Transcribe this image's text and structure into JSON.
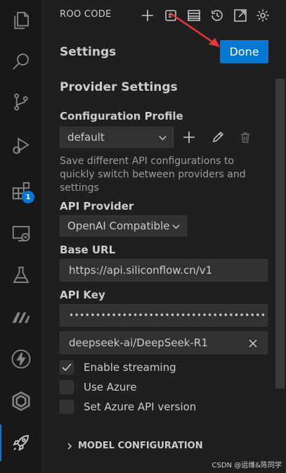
{
  "activity_bar": {
    "items": [
      {
        "icon": "files-icon"
      },
      {
        "icon": "search-icon"
      },
      {
        "icon": "source-control-icon"
      },
      {
        "icon": "run-debug-icon"
      },
      {
        "icon": "extensions-icon",
        "badge": "1"
      },
      {
        "icon": "remote-explorer-icon"
      },
      {
        "icon": "testing-icon"
      },
      {
        "icon": "m-logo-icon"
      },
      {
        "icon": "lightning-icon"
      },
      {
        "icon": "hexagon-icon"
      },
      {
        "icon": "rocket-icon",
        "active": true
      }
    ]
  },
  "header": {
    "title": "ROO CODE",
    "icons": [
      "plus-icon",
      "mcp-icon",
      "prompts-icon",
      "history-icon",
      "popout-icon",
      "gear-icon"
    ]
  },
  "settings": {
    "title": "Settings",
    "done_label": "Done"
  },
  "provider": {
    "section_title": "Provider Settings",
    "config_profile_label": "Configuration Profile",
    "config_profile_value": "default",
    "config_description": "Save different API configurations to quickly switch between providers and settings",
    "api_provider_label": "API Provider",
    "api_provider_value": "OpenAI Compatible",
    "base_url_label": "Base URL",
    "base_url_value": "https://api.siliconflow.cn/v1",
    "api_key_label": "API Key",
    "api_key_value": "••••••••••••••••••••••••••••••••••••••",
    "model_value": "deepseek-ai/DeepSeek-R1"
  },
  "options": [
    {
      "label": "Enable streaming",
      "checked": true
    },
    {
      "label": "Use Azure",
      "checked": false
    },
    {
      "label": "Set Azure API version",
      "checked": false
    }
  ],
  "model_configuration_label": "MODEL CONFIGURATION",
  "watermark": "CSDN @运维&陈同学",
  "colors": {
    "accent": "#0078d4",
    "annotation_arrow": "#e53935",
    "background": "#1f1f1f"
  }
}
